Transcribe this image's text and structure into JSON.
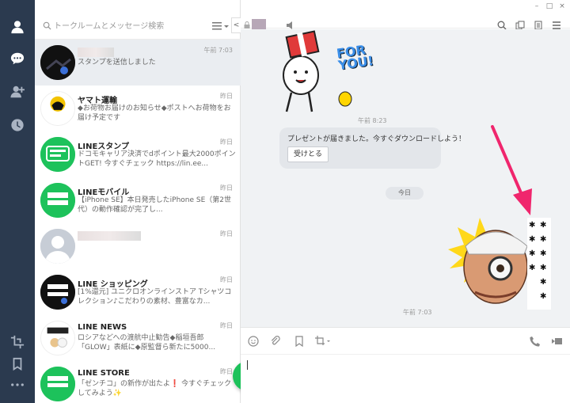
{
  "search": {
    "placeholder": "トークルームとメッセージ検索"
  },
  "list_collapse": "<",
  "chats": [
    {
      "name": "",
      "preview": "スタンプを送信しました",
      "time": "午前 7:03"
    },
    {
      "name": "ヤマト運輸",
      "preview": "◆お荷物お届けのお知らせ◆ポストへお荷物をお届け予定です",
      "time": "昨日",
      "avatar_text": "ヤマト運輸"
    },
    {
      "name": "LINEスタンプ",
      "preview": "ドコモキャリア決済でdポイント最大2000ポイントGET! 今すぐチェック https://lin.ee...",
      "time": "昨日",
      "avatar_text": "LINE スタンプ"
    },
    {
      "name": "LINEモバイル",
      "preview": "【iPhone SE】本日発売したiPhone SE（第2世代）の動作確認が完了し...",
      "time": "昨日",
      "avatar_text": "LINE MOBILE"
    },
    {
      "name": "",
      "preview": "",
      "time": "昨日"
    },
    {
      "name": "LINE ショッピング",
      "preview": "[1%還元] ユニクロオンラインストア Tシャツコレクション♪こだわりの素材、豊富なカ...",
      "time": "昨日",
      "avatar_text": "LINE ショッピング"
    },
    {
      "name": "LINE NEWS",
      "preview": "ロシアなどへの渡航中止勧告◆稲垣吾郎「GLOW」表紙に◆原監督ら新たに5000...",
      "time": "昨日",
      "avatar_text": "NEWS"
    },
    {
      "name": "LINE STORE",
      "preview": "「ゼンチコ」の新作が出たよ❗ 今すぐチェックしてみよう✨",
      "time": "昨日",
      "avatar_text": "LINE STORE"
    }
  ],
  "fab_label": "+",
  "window_controls": [
    "–",
    "□",
    "×"
  ],
  "messages": {
    "sticker1_text": "FOR YOU!",
    "time1": "午前 8:23",
    "present_text": "プレゼントが届きました。今すぐダウンロードしよう！",
    "receive_button": "受けとる",
    "date_divider": "今日",
    "time2": "午前 7:03"
  },
  "colors": {
    "rail": "#2b3a4f",
    "line_green": "#1dc25b",
    "arrow": "#f0266d",
    "selected_row": "#eaedf1"
  },
  "icons": {
    "rail": [
      "person-icon",
      "chat-bubble-icon",
      "add-friend-icon",
      "clock-icon",
      "crop-icon",
      "bookmark-icon",
      "more-icon"
    ],
    "header": [
      "search-icon",
      "copy-icon",
      "notes-icon",
      "menu-icon"
    ],
    "composer": [
      "emoji-icon",
      "attach-icon",
      "bookmark-icon",
      "screenshot-icon",
      "call-icon",
      "video-call-icon"
    ]
  }
}
